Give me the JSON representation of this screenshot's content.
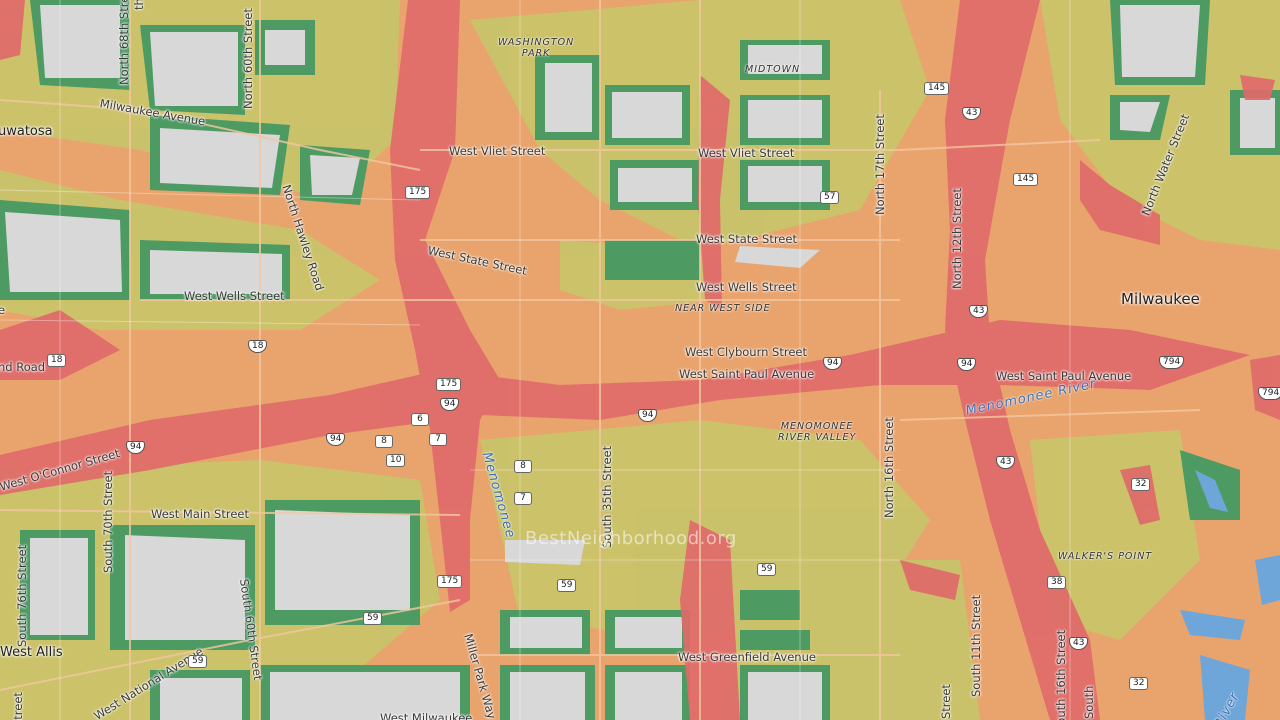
{
  "map": {
    "attribution": "BestNeighborhood.org",
    "colors": {
      "high": "#e06a6a",
      "mid": "#eaa06a",
      "low": "#c8c86a",
      "lowest": "#4f9a62",
      "block": "#d9d9d9",
      "water": "#6fa6da"
    },
    "cities": {
      "milwaukee": "Milwaukee",
      "wauwatosa": "uwatosa",
      "west_allis": "West Allis"
    },
    "neighborhoods": {
      "washington_park_1": "WASHINGTON",
      "washington_park_2": "PARK",
      "midtown": "MIDTOWN",
      "near_west_side": "NEAR WEST SIDE",
      "menomonee_1": "MENOMONEE",
      "menomonee_2": "RIVER VALLEY",
      "walkers_point": "WALKER'S POINT"
    },
    "streets": {
      "n68": "North 68th Street",
      "n60": "North 60th Street",
      "milwaukee_ave": "Milwaukee Avenue",
      "hawley": "North Hawley Road",
      "vliet_1": "West Vliet Street",
      "vliet_2": "West Vliet Street",
      "state_1": "West State Street",
      "state_2": "West State Street",
      "wells_1": "West Wells Street",
      "wells_2": "West Wells Street",
      "clybourn": "West Clybourn Street",
      "st_paul_1": "West Saint Paul Avenue",
      "st_paul_2": "West Saint Paul Avenue",
      "n17": "North 17th Street",
      "n12": "North 12th Street",
      "n16": "North 16th Street",
      "water_st": "North Water Street",
      "oconnor": "West O'Connor Street",
      "s70": "South 70th Street",
      "s76": "South 76th Street",
      "main": "West Main Street",
      "s60": "South 60th Street",
      "s35": "South 35th Street",
      "miller": "Miller Park Way",
      "greenfield": "West Greenfield Avenue",
      "national": "West National Avenue",
      "s11": "South 11th Street",
      "s16": "South 16th Street",
      "s_south": "South",
      "w_milw": "West Milwaukee",
      "road18": "nd Road",
      "wauw_e": "e",
      "st_s": "Street",
      "th": "th Street",
      "s_street": "Street"
    },
    "water": {
      "menomonee_river": "Menomonee River",
      "menomonee_creek": "Menomonee",
      "river_r": "River"
    },
    "shields": {
      "s145a": "145",
      "s145b": "145",
      "s43a": "43",
      "s43b": "43",
      "s43c": "43",
      "s43d": "43",
      "s175a": "175",
      "s175b": "175",
      "s175c": "175",
      "s57": "57",
      "s18a": "18",
      "s18b": "18",
      "s94a": "94",
      "s94b": "94",
      "s94c": "94",
      "s94d": "94",
      "s94e": "94",
      "s94f": "94",
      "s794a": "794",
      "s794b": "794",
      "s6": "6",
      "s7a": "7",
      "s7b": "7",
      "s8a": "8",
      "s8b": "8",
      "s10": "10",
      "s59a": "59",
      "s59b": "59",
      "s59c": "59",
      "s59d": "59",
      "s32a": "32",
      "s32b": "32",
      "s38": "38"
    }
  }
}
